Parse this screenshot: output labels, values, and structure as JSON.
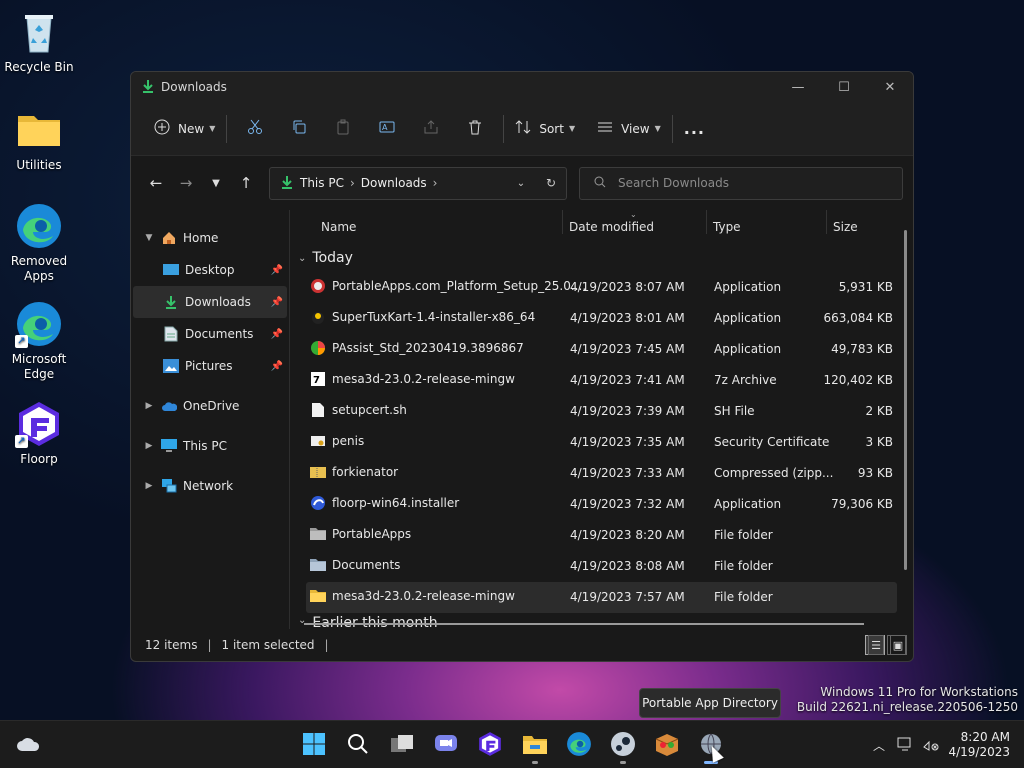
{
  "desktop": {
    "icons": [
      {
        "label": "Recycle Bin"
      },
      {
        "label": "Utilities"
      },
      {
        "label": "Removed Apps"
      },
      {
        "label": "Microsoft Edge"
      },
      {
        "label": "Floorp"
      }
    ]
  },
  "window": {
    "title": "Downloads",
    "commands": {
      "new": "New",
      "sort": "Sort",
      "view": "View",
      "more": "..."
    },
    "address": {
      "this_pc": "This PC",
      "downloads": "Downloads"
    },
    "search_placeholder": "Search Downloads",
    "nav": {
      "home": "Home",
      "desktop": "Desktop",
      "downloads": "Downloads",
      "documents": "Documents",
      "pictures": "Pictures",
      "onedrive": "OneDrive",
      "thispc": "This PC",
      "network": "Network"
    },
    "columns": {
      "name": "Name",
      "date": "Date modified",
      "type": "Type",
      "size": "Size"
    },
    "groups": {
      "today": "Today",
      "earlier": "Earlier this month"
    },
    "files": [
      {
        "name": "PortableApps.com_Platform_Setup_25.0....",
        "date": "4/19/2023 8:07 AM",
        "type": "Application",
        "size": "5,931 KB",
        "icon": "portableapps-setup-icon"
      },
      {
        "name": "SuperTuxKart-1.4-installer-x86_64",
        "date": "4/19/2023 8:01 AM",
        "type": "Application",
        "size": "663,084 KB",
        "icon": "supertuxkart-icon"
      },
      {
        "name": "PAssist_Std_20230419.3896867",
        "date": "4/19/2023 7:45 AM",
        "type": "Application",
        "size": "49,783 KB",
        "icon": "passist-icon"
      },
      {
        "name": "mesa3d-23.0.2-release-mingw",
        "date": "4/19/2023 7:41 AM",
        "type": "7z Archive",
        "size": "120,402 KB",
        "icon": "7z-archive-icon"
      },
      {
        "name": "setupcert.sh",
        "date": "4/19/2023 7:39 AM",
        "type": "SH File",
        "size": "2 KB",
        "icon": "file-icon"
      },
      {
        "name": "penis",
        "date": "4/19/2023 7:35 AM",
        "type": "Security Certificate",
        "size": "3 KB",
        "icon": "certificate-icon"
      },
      {
        "name": "forkienator",
        "date": "4/19/2023 7:33 AM",
        "type": "Compressed (zipp...",
        "size": "93 KB",
        "icon": "zip-folder-icon"
      },
      {
        "name": "floorp-win64.installer",
        "date": "4/19/2023 7:32 AM",
        "type": "Application",
        "size": "79,306 KB",
        "icon": "floorp-installer-icon"
      },
      {
        "name": "PortableApps",
        "date": "4/19/2023 8:20 AM",
        "type": "File folder",
        "size": "",
        "icon": "folder-dark-icon"
      },
      {
        "name": "Documents",
        "date": "4/19/2023 8:08 AM",
        "type": "File folder",
        "size": "",
        "icon": "documents-folder-icon"
      },
      {
        "name": "mesa3d-23.0.2-release-mingw",
        "date": "4/19/2023 7:57 AM",
        "type": "File folder",
        "size": "",
        "icon": "folder-icon"
      }
    ],
    "status": {
      "count": "12 items",
      "selected": "1 item selected"
    }
  },
  "tooltip": "Portable App Directory",
  "watermark": {
    "line1": "Windows 11 Pro for Workstations",
    "line2": "Build 22621.ni_release.220506-1250"
  },
  "clock": {
    "time": "8:20 AM",
    "date": "4/19/2023"
  }
}
